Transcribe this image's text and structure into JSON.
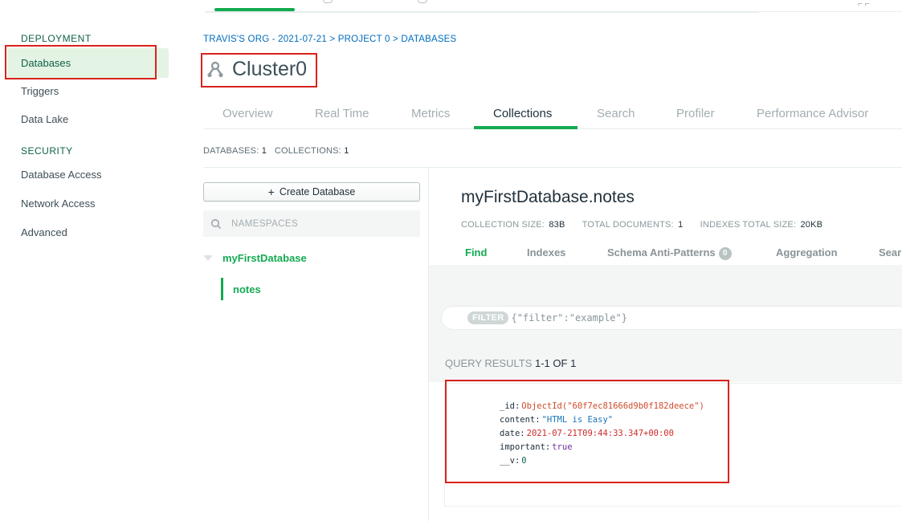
{
  "sidebar": {
    "deployment_heading": "DEPLOYMENT",
    "deployment_items": [
      {
        "label": "Databases",
        "active": true
      },
      {
        "label": "Triggers"
      },
      {
        "label": "Data Lake"
      }
    ],
    "security_heading": "SECURITY",
    "security_items": [
      {
        "label": "Database Access"
      },
      {
        "label": "Network Access"
      },
      {
        "label": "Advanced"
      }
    ]
  },
  "header": {
    "breadcrumb": [
      "TRAVIS'S ORG - 2021-07-21",
      "PROJECT 0",
      "DATABASES"
    ],
    "breadcrumb_sep": ">",
    "cluster_name": "Cluster0",
    "cluster_icon": "cluster-icon"
  },
  "tabs": [
    {
      "label": "Overview"
    },
    {
      "label": "Real Time"
    },
    {
      "label": "Metrics"
    },
    {
      "label": "Collections",
      "active": true
    },
    {
      "label": "Search"
    },
    {
      "label": "Profiler"
    },
    {
      "label": "Performance Advisor"
    }
  ],
  "counts": {
    "databases_label": "DATABASES:",
    "databases_value": "1",
    "collections_label": "COLLECTIONS:",
    "collections_value": "1"
  },
  "namespaces": {
    "create_button": "Create Database",
    "create_icon": "plus-icon",
    "search_placeholder": "NAMESPACES",
    "database_name": "myFirstDatabase",
    "collection_name": "notes"
  },
  "collection": {
    "title": "myFirstDatabase.notes",
    "size_label": "COLLECTION SIZE:",
    "size_value": "83B",
    "docs_label": "TOTAL DOCUMENTS:",
    "docs_value": "1",
    "index_label": "INDEXES TOTAL SIZE:",
    "index_value": "20KB",
    "subtabs": [
      {
        "label": "Find",
        "active": true
      },
      {
        "label": "Indexes"
      },
      {
        "label": "Schema Anti-Patterns",
        "badge": "0"
      },
      {
        "label": "Aggregation"
      },
      {
        "label": "Sear"
      }
    ]
  },
  "query": {
    "filter_tag": "FILTER",
    "filter_placeholder": "{\"filter\":\"example\"}",
    "results_label": "QUERY RESULTS",
    "results_range": "1-1 OF 1"
  },
  "document": {
    "fields": [
      {
        "key": "_id",
        "value": "ObjectId(\"60f7ec81666d9b0f182deece\")",
        "type": "oid"
      },
      {
        "key": "content",
        "value": "\"HTML is Easy\"",
        "type": "str"
      },
      {
        "key": "date",
        "value": "2021-07-21T09:44:33.347+00:00",
        "type": "date"
      },
      {
        "key": "important",
        "value": "true",
        "type": "bool"
      },
      {
        "key": "__v",
        "value": "0",
        "type": "num"
      }
    ]
  },
  "colors": {
    "accent_green": "#13aa52",
    "highlight_red": "#d9221c",
    "link_blue": "#006cbc"
  }
}
